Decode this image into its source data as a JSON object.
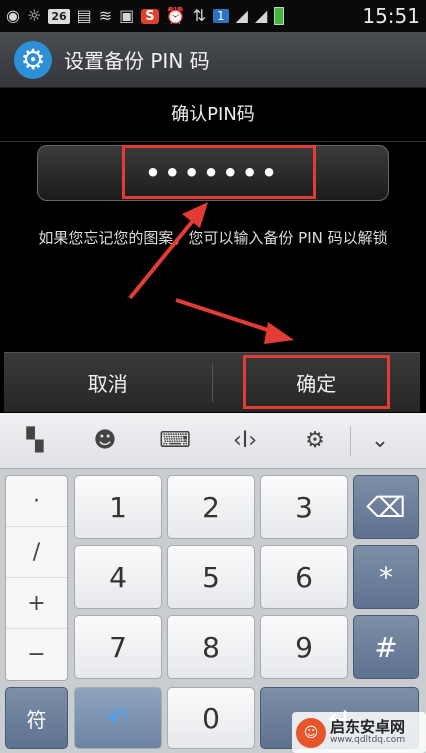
{
  "statusbar": {
    "time": "15:51",
    "date_badge": "26",
    "s_badge": "S",
    "sim_badge": "1",
    "icons": [
      "network-icon",
      "brightness-icon",
      "calendar-icon",
      "keyboard-icon",
      "wifi-icon",
      "image-icon",
      "s-app-icon",
      "alarm-icon",
      "data-icon",
      "sim-icon",
      "signal-icon",
      "battery-icon"
    ]
  },
  "titlebar": {
    "title": "设置备份 PIN 码"
  },
  "dialog": {
    "label": "确认PIN码",
    "pin_value": "•••••••",
    "hint": "如果您忘记您的图案，您可以输入备份 PIN 码以解锁",
    "cancel_label": "取消",
    "ok_label": "确定"
  },
  "keyboard": {
    "side_keys": [
      "·",
      "/",
      "+",
      "−"
    ],
    "rows": [
      [
        "1",
        "2",
        "3"
      ],
      [
        "4",
        "5",
        "6"
      ],
      [
        "7",
        "8",
        "9"
      ]
    ],
    "star": "*",
    "hash": "#",
    "symbol_key": "符",
    "zero": "0"
  },
  "watermark": {
    "name": "启东安卓网",
    "url": "www.qdltdq.com"
  },
  "colors": {
    "accent": "#2d8fd8",
    "highlight": "#e23c34"
  }
}
